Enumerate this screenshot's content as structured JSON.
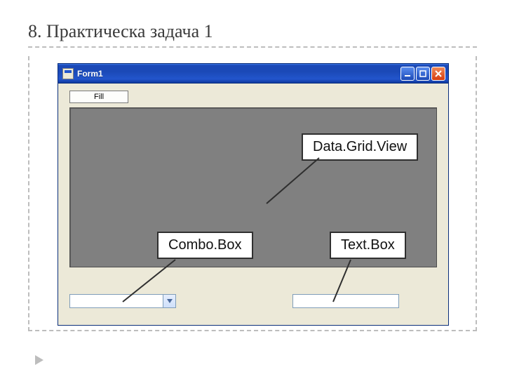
{
  "slide": {
    "title": "8. Практическа задача 1"
  },
  "window": {
    "title": "Form1"
  },
  "controls": {
    "fill_button_label": "Fill",
    "combo_value": ""
  },
  "annotations": {
    "datagridview": "Data.Grid.View",
    "combobox": "Combo.Box",
    "textbox": "Text.Box"
  }
}
